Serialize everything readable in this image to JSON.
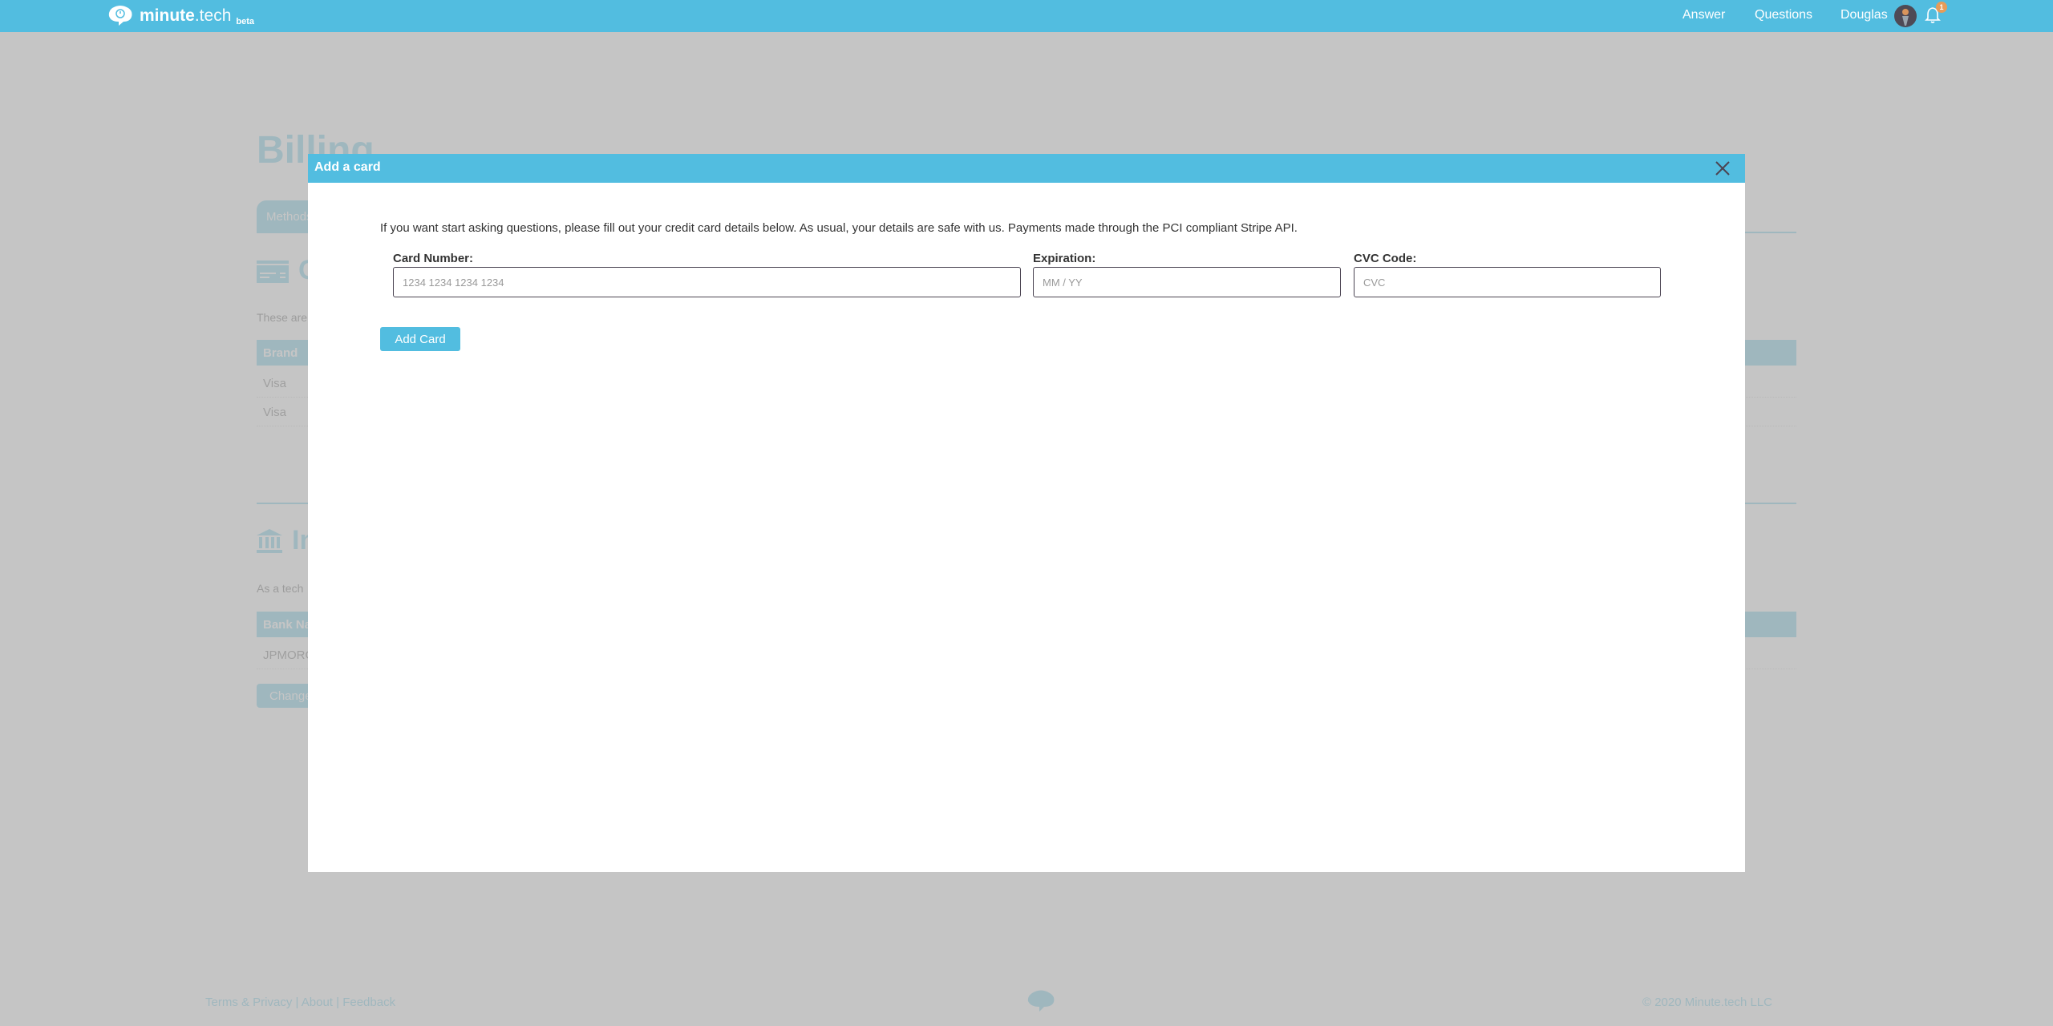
{
  "navbar": {
    "logo": {
      "word_bold": "minute",
      "word_light": ".tech",
      "badge": "beta"
    },
    "links": [
      {
        "label": "Answer"
      },
      {
        "label": "Questions"
      },
      {
        "label": "Douglas"
      }
    ],
    "notifications_count": "1",
    "colors": {
      "brand": "#52bde0",
      "badge": "#e69c5a"
    }
  },
  "page": {
    "title": "Billing",
    "tab_active": "Methods",
    "cards_section": {
      "title": "Cards",
      "description": "These are",
      "table_header": [
        "Brand"
      ],
      "rows": [
        [
          "Visa"
        ],
        [
          "Visa"
        ]
      ]
    },
    "income_section": {
      "title": "Income",
      "description": "As a tech",
      "table_header": [
        "Bank Name"
      ],
      "rows": [
        [
          "JPMORGAN"
        ]
      ],
      "change_button": "Change"
    }
  },
  "footer": {
    "links": [
      "Terms & Privacy",
      "About",
      "Feedback"
    ],
    "separator": " | ",
    "copyright": "© 2020 Minute.tech LLC"
  },
  "modal": {
    "title": "Add a card",
    "description": "If you want start asking questions, please fill out your credit card details below. As usual, your details are safe with us. Payments made through the PCI compliant Stripe API.",
    "fields": {
      "card_number": {
        "label": "Card Number:",
        "placeholder": "1234 1234 1234 1234",
        "value": ""
      },
      "expiration": {
        "label": "Expiration:",
        "placeholder": "MM / YY",
        "value": ""
      },
      "cvc": {
        "label": "CVC Code:",
        "placeholder": "CVC",
        "value": ""
      }
    },
    "submit_label": "Add Card"
  }
}
